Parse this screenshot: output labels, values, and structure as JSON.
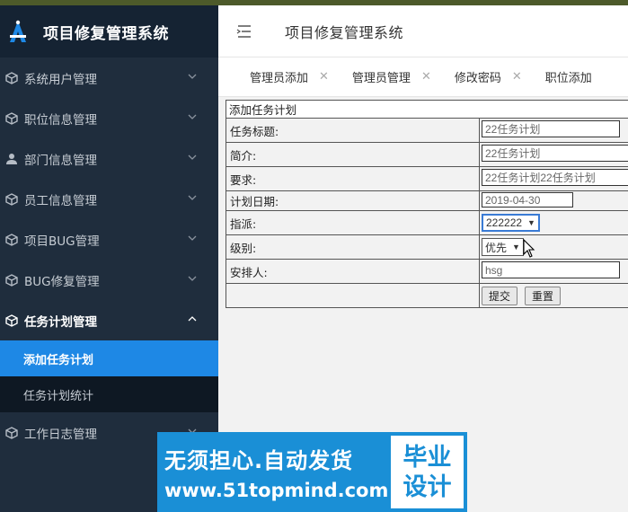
{
  "app": {
    "title": "项目修复管理系统"
  },
  "sidebar": {
    "items": [
      {
        "label": "系统用户管理",
        "icon": "cube-icon"
      },
      {
        "label": "职位信息管理",
        "icon": "cube-icon"
      },
      {
        "label": "部门信息管理",
        "icon": "user-icon"
      },
      {
        "label": "员工信息管理",
        "icon": "cube-icon"
      },
      {
        "label": "项目BUG管理",
        "icon": "cube-icon"
      },
      {
        "label": "BUG修复管理",
        "icon": "cube-icon"
      },
      {
        "label": "任务计划管理",
        "icon": "cube-icon",
        "expanded": true
      },
      {
        "label": "工作日志管理",
        "icon": "cube-icon"
      }
    ],
    "subitems": [
      {
        "label": "添加任务计划",
        "selected": true
      },
      {
        "label": "任务计划统计",
        "selected": false
      }
    ]
  },
  "header": {
    "title": "项目修复管理系统"
  },
  "tabs": [
    {
      "label": "管理员添加"
    },
    {
      "label": "管理员管理"
    },
    {
      "label": "修改密码"
    },
    {
      "label": "职位添加"
    }
  ],
  "form": {
    "caption": "添加任务计划",
    "fields": {
      "title": {
        "label": "任务标题:",
        "value": "22任务计划"
      },
      "intro": {
        "label": "简介:",
        "value": "22任务计划"
      },
      "req": {
        "label": "要求:",
        "value": "22任务计划22任务计划"
      },
      "date": {
        "label": "计划日期:",
        "value": "2019-04-30"
      },
      "assign": {
        "label": "指派:",
        "value": "222222"
      },
      "level": {
        "label": "级别:",
        "value": "优先"
      },
      "arranger": {
        "label": "安排人:",
        "value": "hsg"
      }
    },
    "submit": "提交",
    "reset": "重置"
  },
  "watermark": {
    "line1": "无须担心.自动发货",
    "line2": "www.51topmind.com",
    "badge1": "毕业",
    "badge2": "设计"
  },
  "colors": {
    "sidebar": "#1f2d3d",
    "selected": "#1e88e5",
    "watermark": "#1a8fd6"
  }
}
